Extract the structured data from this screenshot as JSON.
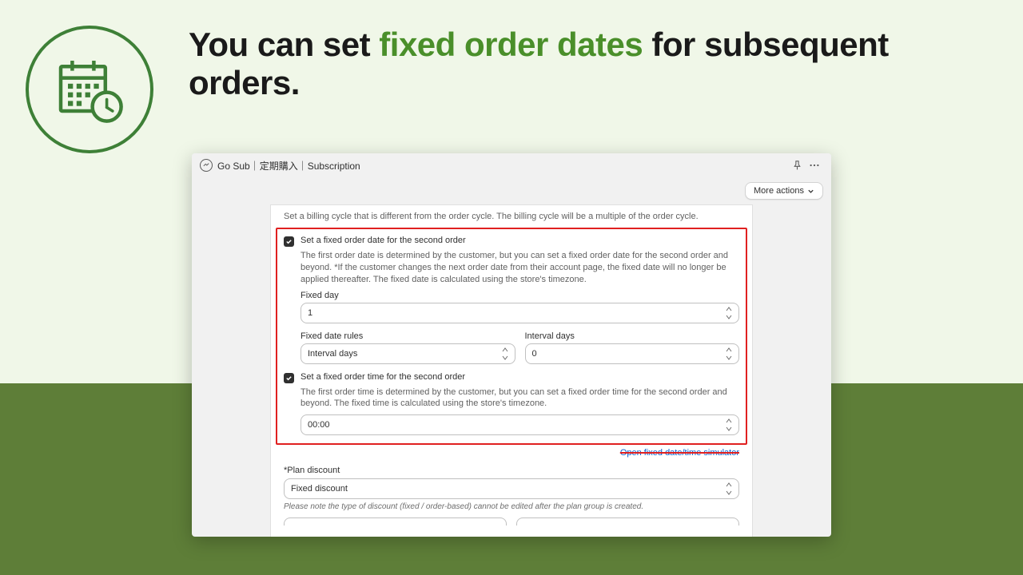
{
  "headline": {
    "pre": "You can set ",
    "accent": "fixed order dates",
    "post": " for subsequent orders."
  },
  "appBar": {
    "title": "Go Sub｜定期購入｜Subscription",
    "moreActions": "More actions"
  },
  "intro": "Set a billing cycle that is different from the order cycle. The billing cycle will be a multiple of the order cycle.",
  "fixedDate": {
    "checkboxLabel": "Set a fixed order date for the second order",
    "description": "The first order date is determined by the customer, but you can set a fixed order date for the second order and beyond. *If the customer changes the next order date from their account page, the fixed date will no longer be applied thereafter. The fixed date is calculated using the store's timezone.",
    "fixedDayLabel": "Fixed day",
    "fixedDayValue": "1",
    "rulesLabel": "Fixed date rules",
    "rulesValue": "Interval days",
    "intervalLabel": "Interval days",
    "intervalValue": "0"
  },
  "fixedTime": {
    "checkboxLabel": "Set a fixed order time for the second order",
    "description": "The first order time is determined by the customer, but you can set a fixed order time for the second order and beyond. The fixed time is calculated using the store's timezone.",
    "timeValue": "00:00"
  },
  "simulatorLink": "Open fixed date/time simulator",
  "discount": {
    "label": "*Plan discount",
    "value": "Fixed discount",
    "note": "Please note the type of discount (fixed / order-based) cannot be edited after the plan group is created."
  }
}
